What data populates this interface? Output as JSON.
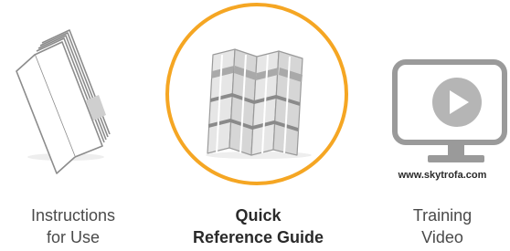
{
  "items": [
    {
      "icon": "booklet-icon",
      "line1": "Instructions",
      "line2": "for Use",
      "selected": false
    },
    {
      "icon": "folded-map-icon",
      "line1": "Quick",
      "line2": "Reference Guide",
      "selected": true
    },
    {
      "icon": "video-monitor-icon",
      "line1": "Training",
      "line2": "Video",
      "selected": false,
      "url": "www.skytrofa.com"
    }
  ],
  "colors": {
    "highlight_ring": "#F5A623",
    "icon_gray": "#9a9a9a",
    "icon_light": "#e6e6e6"
  }
}
